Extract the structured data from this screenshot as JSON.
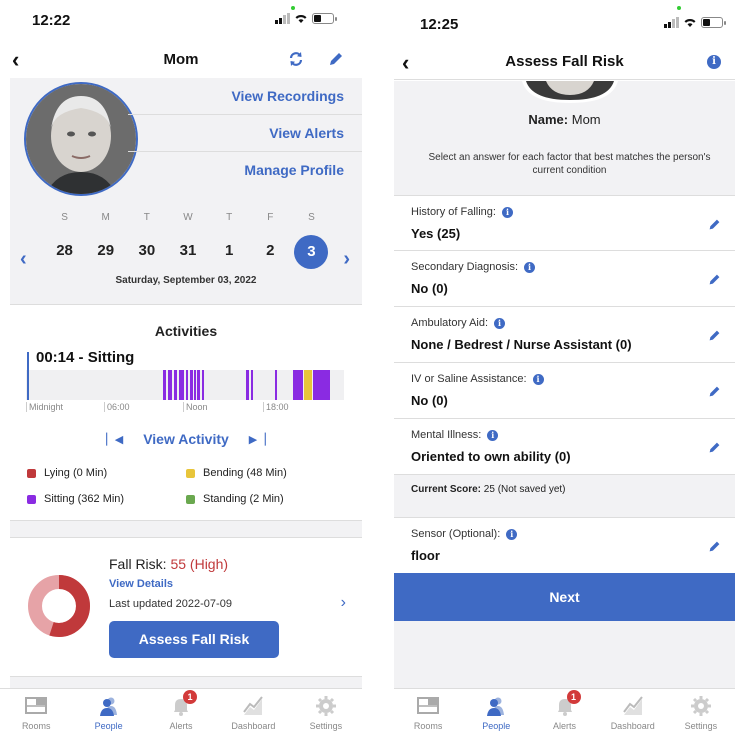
{
  "left": {
    "status_time": "12:22",
    "title": "Mom",
    "links": [
      "View Recordings",
      "View Alerts",
      "Manage Profile"
    ],
    "calendar": {
      "day_names": [
        "S",
        "M",
        "T",
        "W",
        "T",
        "F",
        "S"
      ],
      "dates": [
        "28",
        "29",
        "30",
        "31",
        "1",
        "2",
        "3"
      ],
      "selected_index": 6,
      "date_label": "Saturday, September 03, 2022"
    },
    "activities": {
      "title": "Activities",
      "current": "00:14 - Sitting",
      "axis_labels": [
        "Midnight",
        "06:00",
        "Noon",
        "18:00"
      ],
      "view_activity": "View Activity",
      "legend": [
        {
          "label": "Lying (0 Min)",
          "color": "#c0393b"
        },
        {
          "label": "Bending (48 Min)",
          "color": "#e8c53a"
        },
        {
          "label": "Sitting (362 Min)",
          "color": "#8a2be2"
        },
        {
          "label": "Standing (2 Min)",
          "color": "#6aa84f"
        }
      ]
    },
    "fall_risk": {
      "label": "Fall Risk:",
      "value": "55 (High)",
      "view_details": "View Details",
      "updated": "Last updated 2022-07-09",
      "button": "Assess Fall Risk"
    }
  },
  "right": {
    "status_time": "12:25",
    "title": "Assess Fall Risk",
    "name_label": "Name:",
    "name_value": "Mom",
    "instructions": "Select an answer for each factor that best matches the person's current condition",
    "fields": [
      {
        "label": "History of Falling:",
        "value": "Yes (25)"
      },
      {
        "label": "Secondary Diagnosis:",
        "value": "No (0)"
      },
      {
        "label": "Ambulatory Aid:",
        "value": "None / Bedrest / Nurse Assistant (0)"
      },
      {
        "label": "IV or Saline Assistance:",
        "value": "No (0)"
      },
      {
        "label": "Mental Illness:",
        "value": "Oriented to own ability (0)"
      }
    ],
    "score_label": "Current Score:",
    "score_value": "25 (Not saved yet)",
    "sensor_label": "Sensor (Optional):",
    "sensor_value": "floor",
    "next": "Next"
  },
  "tabs": [
    {
      "label": "Rooms",
      "icon": "rooms-icon"
    },
    {
      "label": "People",
      "icon": "people-icon"
    },
    {
      "label": "Alerts",
      "icon": "bell-icon",
      "badge": "1"
    },
    {
      "label": "Dashboard",
      "icon": "dashboard-icon"
    },
    {
      "label": "Settings",
      "icon": "gear-icon"
    }
  ],
  "colors": {
    "accent": "#3f6ac4",
    "danger": "#c0393b",
    "sitting": "#8a2be2",
    "bending": "#e8c53a"
  }
}
